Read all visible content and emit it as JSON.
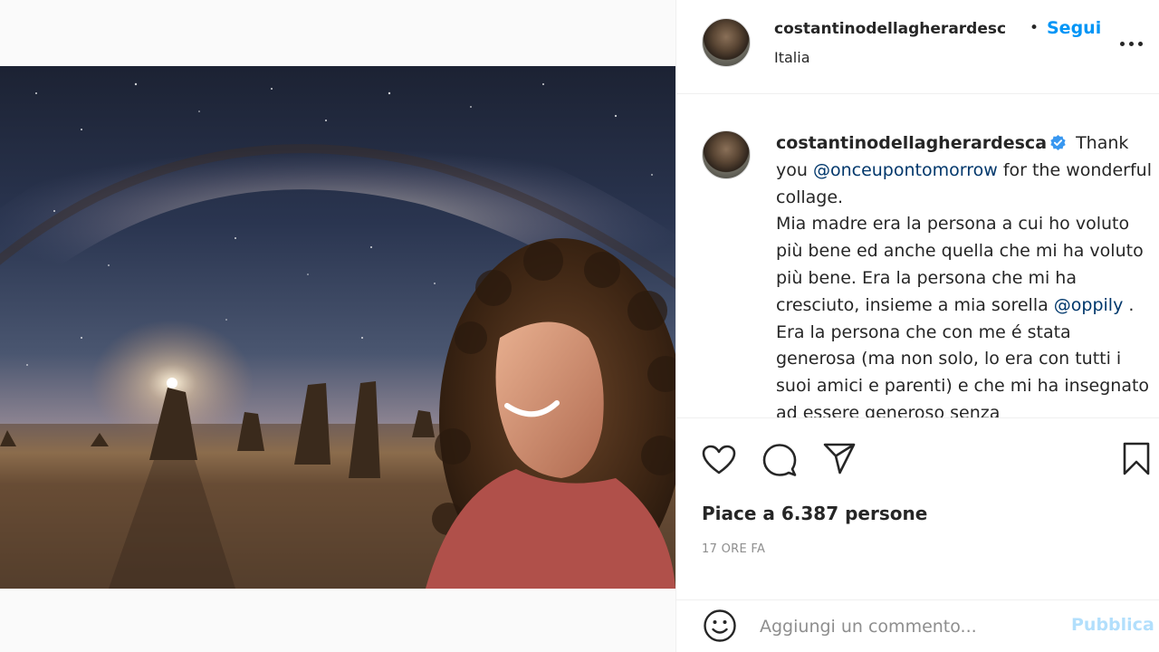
{
  "header": {
    "username": "costantinodellagherardesc",
    "separator": "•",
    "follow_label": "Segui",
    "location": "Italia",
    "more_icon": "more-options-icon"
  },
  "caption": {
    "username": "costantinodellagherardesca",
    "verified_icon": "verified-badge-icon",
    "text_1": " Thank you ",
    "mention_1": "@onceupontomorrow",
    "text_2": " for the wonderful collage.",
    "text_3": "Mia madre era la persona a cui ho voluto più bene ed anche quella che mi ha voluto più bene. Era la persona che mi ha cresciuto, insieme a mia sorella ",
    "mention_2": "@oppily",
    "text_4": " . Era la persona che con me é stata generosa (ma non solo, lo era con tutti i suoi amici e parenti) e che mi ha insegnato ad essere generoso senza"
  },
  "actions": {
    "like_icon": "heart-icon",
    "comment_icon": "comment-icon",
    "share_icon": "share-icon",
    "save_icon": "bookmark-icon",
    "likes_label": "Piace a 6.387 persone",
    "time_label": "17 ORE FA"
  },
  "comment": {
    "emoji_icon": "emoji-icon",
    "placeholder": "Aggiungi un commento...",
    "publish_label": "Pubblica"
  },
  "colors": {
    "accent": "#0095f6",
    "mention": "#00376b",
    "publish_disabled": "#b2dffc",
    "secondary_text": "#8e8e8e"
  }
}
